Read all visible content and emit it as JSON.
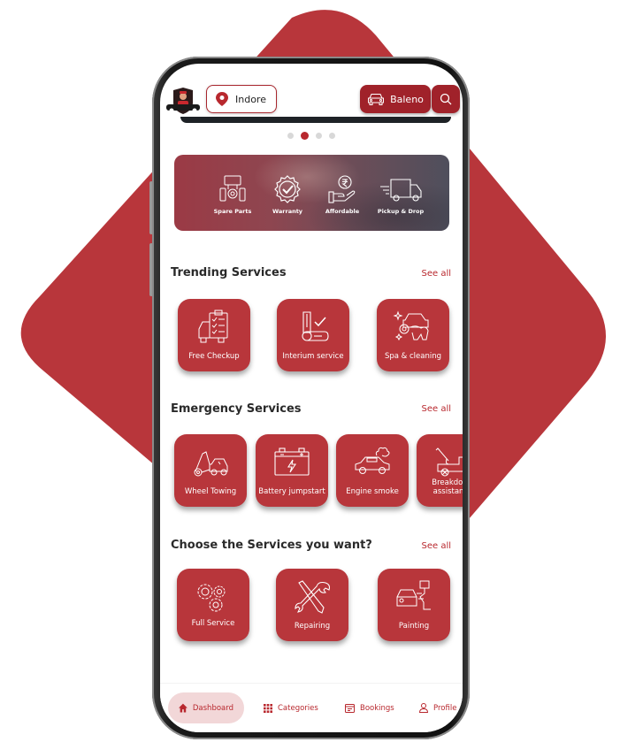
{
  "colors": {
    "brand": "#b8363b",
    "brand_dark": "#a0222a",
    "nav_active_bg": "#f2d7d8",
    "text_dark": "#2a2a2a"
  },
  "header": {
    "logo_icon": "mechanic-logo-icon",
    "location": {
      "icon": "map-pin-icon",
      "label": "Indore"
    },
    "vehicle": {
      "icon": "car-icon",
      "label": "Baleno"
    },
    "search": {
      "icon": "search-icon"
    }
  },
  "carousel": {
    "total_dots": 4,
    "active_index": 1
  },
  "promo_banner": {
    "items": [
      {
        "icon": "spare-parts-icon",
        "label": "Spare Parts"
      },
      {
        "icon": "warranty-badge-icon",
        "label": "Warranty"
      },
      {
        "icon": "rupee-hand-icon",
        "label": "Affordable"
      },
      {
        "icon": "delivery-truck-icon",
        "label": "Pickup & Drop"
      }
    ]
  },
  "sections": {
    "trending": {
      "title": "Trending Services",
      "see_all": "See all",
      "items": [
        {
          "icon": "checkup-clipboard-icon",
          "label": "Free Checkup"
        },
        {
          "icon": "car-seat-icon",
          "label": "Interium service"
        },
        {
          "icon": "car-wash-icon",
          "label": "Spa & cleaning"
        }
      ]
    },
    "emergency": {
      "title": "Emergency Services",
      "see_all": "See all",
      "items": [
        {
          "icon": "tow-truck-icon",
          "label": "Wheel Towing"
        },
        {
          "icon": "battery-icon",
          "label": "Battery jumpstart"
        },
        {
          "icon": "engine-smoke-icon",
          "label": "Engine smoke"
        },
        {
          "icon": "breakdown-crane-icon",
          "label": "Breakdown assistance"
        }
      ]
    },
    "choose": {
      "title": "Choose the Services you want?",
      "see_all": "See all",
      "items": [
        {
          "icon": "gears-icon",
          "label": "Full Service"
        },
        {
          "icon": "wrench-screwdriver-icon",
          "label": "Repairing"
        },
        {
          "icon": "spray-paint-icon",
          "label": "Painting"
        }
      ]
    }
  },
  "bottom_nav": {
    "items": [
      {
        "icon": "home-icon",
        "label": "Dashboard",
        "active": true
      },
      {
        "icon": "grid-icon",
        "label": "Categories",
        "active": false
      },
      {
        "icon": "calendar-icon",
        "label": "Bookings",
        "active": false
      },
      {
        "icon": "user-icon",
        "label": "Profile",
        "active": false
      }
    ]
  }
}
